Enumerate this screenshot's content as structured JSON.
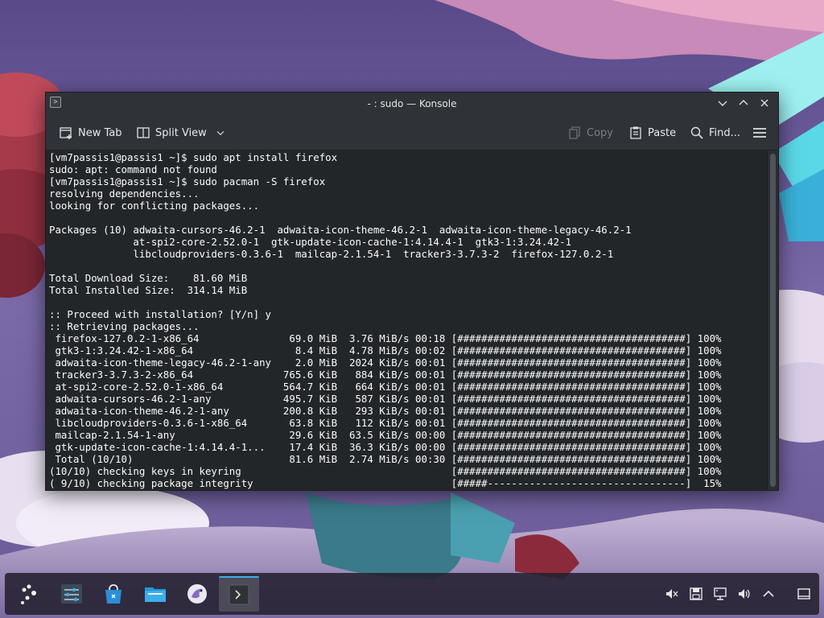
{
  "window": {
    "title": "- : sudo — Konsole"
  },
  "toolbar": {
    "new_tab_label": "New Tab",
    "split_view_label": "Split View",
    "copy_label": "Copy",
    "paste_label": "Paste",
    "find_label": "Find..."
  },
  "terminal": {
    "lines": [
      "[vm7passis1@passis1 ~]$ sudo apt install firefox",
      "sudo: apt: command not found",
      "[vm7passis1@passis1 ~]$ sudo pacman -S firefox",
      "resolving dependencies...",
      "looking for conflicting packages...",
      "",
      "Packages (10) adwaita-cursors-46.2-1  adwaita-icon-theme-46.2-1  adwaita-icon-theme-legacy-46.2-1",
      "              at-spi2-core-2.52.0-1  gtk-update-icon-cache-1:4.14.4-1  gtk3-1:3.24.42-1",
      "              libcloudproviders-0.3.6-1  mailcap-2.1.54-1  tracker3-3.7.3-2  firefox-127.0.2-1",
      "",
      "Total Download Size:    81.60 MiB",
      "Total Installed Size:  314.14 MiB",
      "",
      ":: Proceed with installation? [Y/n] y",
      ":: Retrieving packages...",
      " firefox-127.0.2-1-x86_64               69.0 MiB  3.76 MiB/s 00:18 [######################################] 100%",
      " gtk3-1:3.24.42-1-x86_64                 8.4 MiB  4.78 MiB/s 00:02 [######################################] 100%",
      " adwaita-icon-theme-legacy-46.2-1-any    2.0 MiB  2024 KiB/s 00:01 [######################################] 100%",
      " tracker3-3.7.3-2-x86_64               765.6 KiB   884 KiB/s 00:01 [######################################] 100%",
      " at-spi2-core-2.52.0-1-x86_64          564.7 KiB   664 KiB/s 00:01 [######################################] 100%",
      " adwaita-cursors-46.2-1-any            495.7 KiB   587 KiB/s 00:01 [######################################] 100%",
      " adwaita-icon-theme-46.2-1-any         200.8 KiB   293 KiB/s 00:01 [######################################] 100%",
      " libcloudproviders-0.3.6-1-x86_64       63.8 KiB   112 KiB/s 00:01 [######################################] 100%",
      " mailcap-2.1.54-1-any                   29.6 KiB  63.5 KiB/s 00:00 [######################################] 100%",
      " gtk-update-icon-cache-1:4.14.4-1...    17.4 KiB  36.3 KiB/s 00:00 [######################################] 100%",
      " Total (10/10)                          81.6 MiB  2.74 MiB/s 00:30 [######################################] 100%",
      "(10/10) checking keys in keyring                                   [######################################] 100%",
      "( 9/10) checking package integrity                                 [#####---------------------------------]  15%"
    ]
  },
  "icons": {
    "app": "terminal-icon",
    "minimize": "chevron-down-icon",
    "maximize": "chevron-up-icon",
    "close": "close-icon",
    "new_tab": "new-tab-icon",
    "split_view": "split-view-icon",
    "copy": "copy-icon",
    "paste": "paste-icon",
    "find": "search-icon",
    "menu": "hamburger-menu-icon"
  },
  "colors": {
    "terminal_bg": "#232629",
    "terminal_fg": "#fcfcfc",
    "titlebar_bg": "#2f3338",
    "accent": "#3daee9"
  }
}
